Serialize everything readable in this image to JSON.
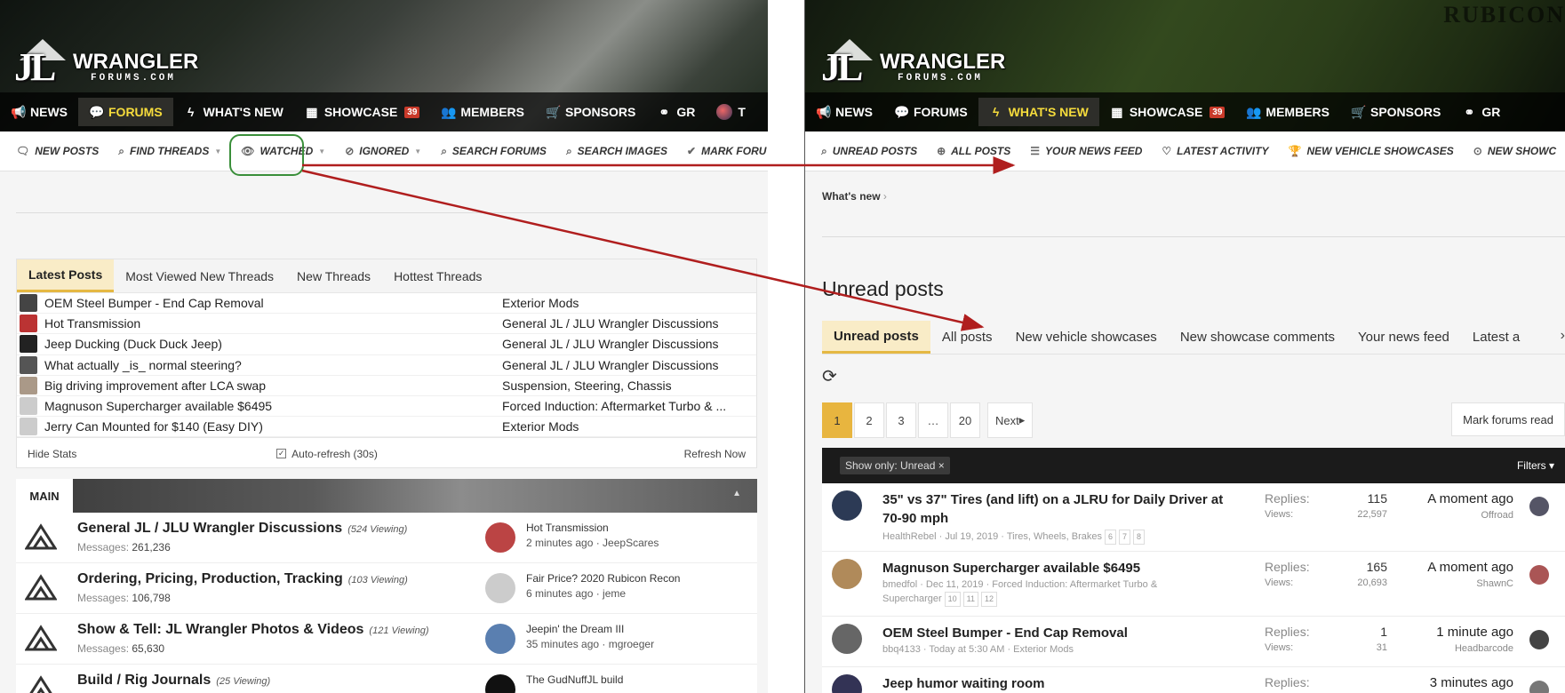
{
  "left": {
    "nav": [
      {
        "label": "NEWS",
        "icon": "megaphone-icon",
        "glyph": "📢"
      },
      {
        "label": "FORUMS",
        "icon": "chat-icon",
        "glyph": "💬",
        "active": true
      },
      {
        "label": "WHAT'S NEW",
        "icon": "bolt-icon",
        "glyph": "ϟ"
      },
      {
        "label": "SHOWCASE",
        "icon": "grid-icon",
        "glyph": "▦",
        "badge": "39"
      },
      {
        "label": "MEMBERS",
        "icon": "users-icon",
        "glyph": "👥"
      },
      {
        "label": "SPONSORS",
        "icon": "cart-icon",
        "glyph": "🛒"
      },
      {
        "label": "GR",
        "icon": "binoculars-icon",
        "glyph": "⚭"
      },
      {
        "label": "T",
        "icon": "avatar-icon",
        "glyph": ""
      }
    ],
    "subnav": [
      {
        "label": "NEW POSTS",
        "glyph": "🗨",
        "icon": "new-posts-icon"
      },
      {
        "label": "FIND THREADS",
        "glyph": "⌕",
        "icon": "search-icon",
        "caret": true
      },
      {
        "label": "WATCHED",
        "glyph": "👁",
        "icon": "eye-icon",
        "caret": true
      },
      {
        "label": "IGNORED",
        "glyph": "⊘",
        "icon": "eye-slash-icon",
        "caret": true
      },
      {
        "label": "SEARCH FORUMS",
        "glyph": "⌕",
        "icon": "search-icon"
      },
      {
        "label": "SEARCH IMAGES",
        "glyph": "⌕",
        "icon": "search-icon"
      },
      {
        "label": "MARK FORU",
        "glyph": "✔",
        "icon": "check-icon"
      }
    ],
    "stats_tabs": [
      "Latest Posts",
      "Most Viewed New Threads",
      "New Threads",
      "Hottest Threads"
    ],
    "stats_rows": [
      {
        "title": "OEM Steel Bumper - End Cap Removal",
        "forum": "Exterior Mods",
        "thumb": "#444"
      },
      {
        "title": "Hot Transmission",
        "forum": "General JL / JLU Wrangler Discussions",
        "thumb": "#b33"
      },
      {
        "title": "Jeep Ducking (Duck Duck Jeep)",
        "forum": "General JL / JLU Wrangler Discussions",
        "thumb": "#222"
      },
      {
        "title": "What actually _is_ normal steering?",
        "forum": "General JL / JLU Wrangler Discussions",
        "thumb": "#555"
      },
      {
        "title": "Big driving improvement after LCA swap",
        "forum": "Suspension, Steering, Chassis",
        "thumb": "#a98"
      },
      {
        "title": "Magnuson Supercharger available $6495",
        "forum": "Forced Induction: Aftermarket Turbo & ...",
        "thumb": "#ccc"
      },
      {
        "title": "Jerry Can Mounted for $140 (Easy DIY)",
        "forum": "Exterior Mods",
        "thumb": "#ccc"
      }
    ],
    "stats_footer": {
      "hide": "Hide Stats",
      "auto": "Auto-refresh (30s)",
      "refresh": "Refresh Now"
    },
    "main_label": "MAIN",
    "forums": [
      {
        "title": "General JL / JLU Wrangler Discussions",
        "viewing": "(524 Viewing)",
        "messages_label": "Messages:",
        "messages": "261,236",
        "last_title": "Hot Transmission",
        "last_meta": "2 minutes ago · JeepScares",
        "avatar": "#b44"
      },
      {
        "title": "Ordering, Pricing, Production, Tracking",
        "viewing": "(103 Viewing)",
        "messages_label": "Messages:",
        "messages": "106,798",
        "last_title": "Fair Price? 2020 Rubicon Recon",
        "last_meta": "6 minutes ago · jeme",
        "avatar": "#ccc"
      },
      {
        "title": "Show & Tell: JL Wrangler Photos & Videos",
        "viewing": "(121 Viewing)",
        "messages_label": "Messages:",
        "messages": "65,630",
        "last_title": "Jeepin' the Dream III",
        "last_meta": "35 minutes ago · mgroeger",
        "avatar": "#5a7fb0"
      },
      {
        "title": "Build / Rig Journals",
        "viewing": "(25 Viewing)",
        "messages_label": "",
        "messages": "",
        "last_title": "The GudNuffJL build",
        "last_meta": "",
        "avatar": "#111"
      }
    ]
  },
  "right": {
    "nav": [
      {
        "label": "NEWS",
        "icon": "megaphone-icon",
        "glyph": "📢"
      },
      {
        "label": "FORUMS",
        "icon": "chat-icon",
        "glyph": "💬"
      },
      {
        "label": "WHAT'S NEW",
        "icon": "bolt-icon",
        "glyph": "ϟ",
        "active": true
      },
      {
        "label": "SHOWCASE",
        "icon": "grid-icon",
        "glyph": "▦",
        "badge": "39"
      },
      {
        "label": "MEMBERS",
        "icon": "users-icon",
        "glyph": "👥"
      },
      {
        "label": "SPONSORS",
        "icon": "cart-icon",
        "glyph": "🛒"
      },
      {
        "label": "GR",
        "icon": "binoculars-icon",
        "glyph": "⚭"
      }
    ],
    "subnav": [
      {
        "label": "UNREAD POSTS",
        "glyph": "⌕",
        "icon": "unread-icon"
      },
      {
        "label": "ALL POSTS",
        "glyph": "⊕",
        "icon": "all-posts-icon"
      },
      {
        "label": "YOUR NEWS FEED",
        "glyph": "☰",
        "icon": "feed-icon"
      },
      {
        "label": "LATEST ACTIVITY",
        "glyph": "♡",
        "icon": "activity-icon"
      },
      {
        "label": "NEW VEHICLE SHOWCASES",
        "glyph": "🏆",
        "icon": "trophy-icon"
      },
      {
        "label": "NEW SHOWC",
        "glyph": "⊙",
        "icon": "comment-icon"
      }
    ],
    "breadcrumb": "What's new",
    "title": "Unread posts",
    "tabs": [
      "Unread posts",
      "All posts",
      "New vehicle showcases",
      "New showcase comments",
      "Your news feed",
      "Latest a"
    ],
    "pages": [
      "1",
      "2",
      "3",
      "…",
      "20",
      "Next"
    ],
    "mark_read": "Mark forums read",
    "filter_chip": "Show only: Unread",
    "filters": "Filters",
    "threads": [
      {
        "title": "35\" vs 37\" Tires (and lift) on a JLRU for Daily Driver at 70-90 mph",
        "meta": "HealthRebel · Jul 19, 2019 · Tires, Wheels, Brakes",
        "pages": [
          "6",
          "7",
          "8"
        ],
        "replies": "115",
        "views": "22,597",
        "when": "A moment ago",
        "who": "Offroad",
        "avatar": "#2c3a55",
        "uav": "#556"
      },
      {
        "title": "Magnuson Supercharger available $6495",
        "meta": "bmedfol · Dec 11, 2019 · Forced Induction: Aftermarket Turbo & Supercharger",
        "pages": [
          "10",
          "11",
          "12"
        ],
        "replies": "165",
        "views": "20,693",
        "when": "A moment ago",
        "who": "ShawnC",
        "avatar": "#b08a5a",
        "uav": "#a55"
      },
      {
        "title": "OEM Steel Bumper - End Cap Removal",
        "meta": "bbq4133 · Today at 5:30 AM · Exterior Mods",
        "pages": [],
        "replies": "1",
        "views": "31",
        "when": "1 minute ago",
        "who": "Headbarcode",
        "avatar": "#666",
        "uav": "#444"
      },
      {
        "title": "Jeep humor waiting room",
        "meta": "",
        "pages": [],
        "replies": "",
        "views": "",
        "when": "3 minutes ago",
        "who": "",
        "avatar": "#335",
        "uav": "#777"
      }
    ],
    "replies_label": "Replies:",
    "views_label": "Views:"
  },
  "logo": {
    "jl": "JL",
    "wrangler": "WRANGLER",
    "forums": "FORUMS.COM"
  },
  "rubicon": "RUBICON",
  "accent": "#e5b843",
  "arrow_color": "#b01e1e",
  "annotation_color": "#3a8f3a"
}
